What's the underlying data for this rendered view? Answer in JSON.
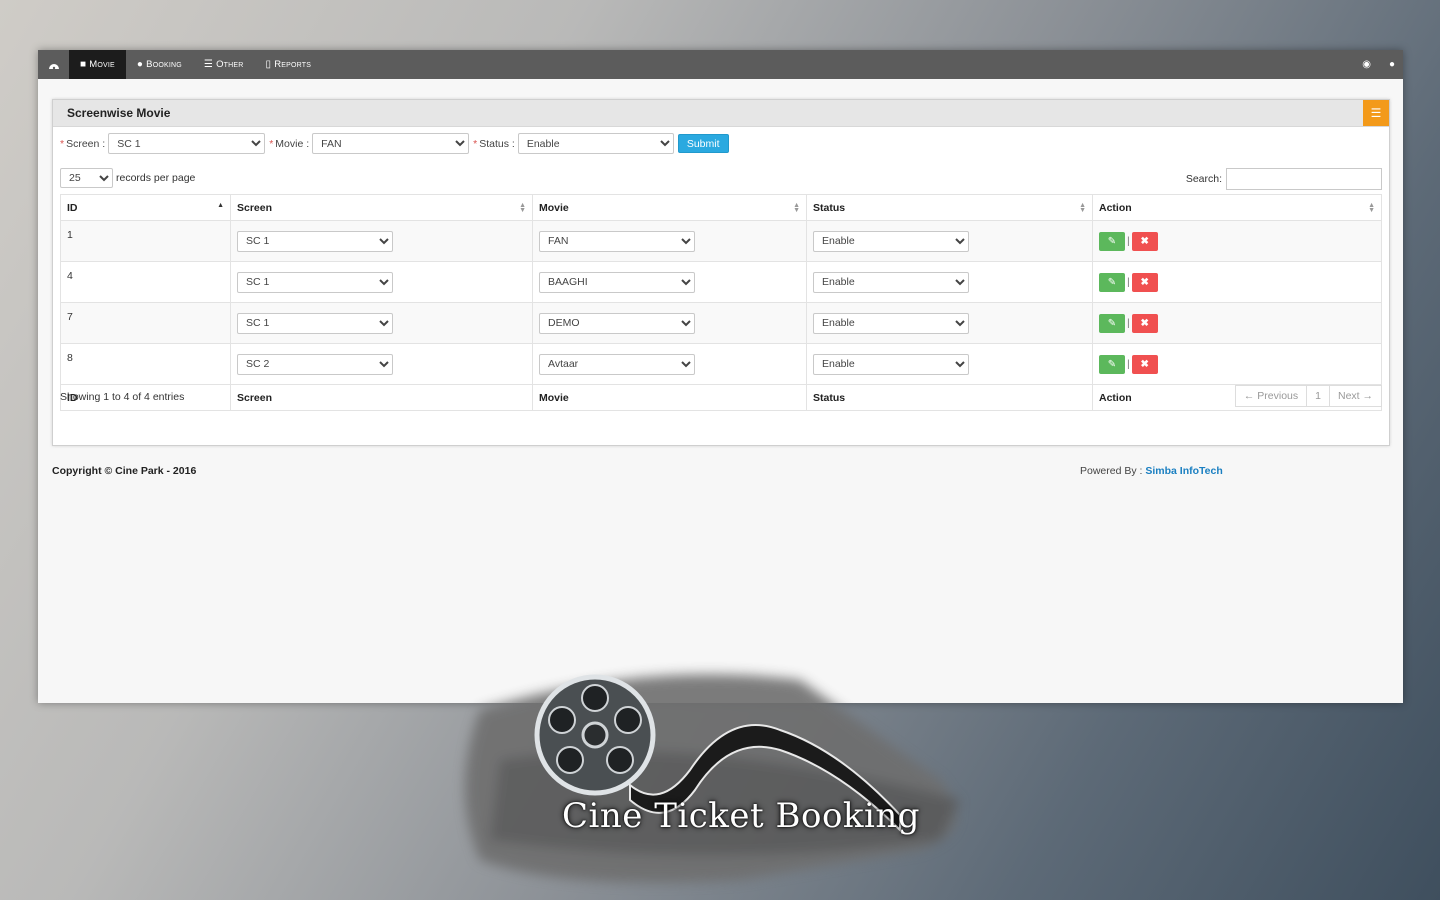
{
  "nav": {
    "items": [
      {
        "label": "Movie",
        "icon": "video-camera-icon",
        "active": true
      },
      {
        "label": "Booking",
        "icon": "user-icon",
        "active": false
      },
      {
        "label": "Other",
        "icon": "list-icon",
        "active": false
      },
      {
        "label": "Reports",
        "icon": "document-icon",
        "active": false
      }
    ]
  },
  "panel": {
    "title": "Screenwise Movie"
  },
  "filter": {
    "screen_label": "Screen :",
    "screen_value": "SC 1",
    "movie_label": "Movie :",
    "movie_value": "FAN",
    "status_label": "Status :",
    "status_value": "Enable",
    "submit_label": "Submit"
  },
  "table_controls": {
    "page_length": "25",
    "records_label": "records per page",
    "search_label": "Search:"
  },
  "table": {
    "headers": [
      "ID",
      "Screen",
      "Movie",
      "Status",
      "Action"
    ],
    "rows": [
      {
        "id": "1",
        "screen": "SC 1",
        "movie": "FAN",
        "status": "Enable"
      },
      {
        "id": "4",
        "screen": "SC 1",
        "movie": "BAAGHI",
        "status": "Enable"
      },
      {
        "id": "7",
        "screen": "SC 1",
        "movie": "DEMO",
        "status": "Enable"
      },
      {
        "id": "8",
        "screen": "SC 2",
        "movie": "Avtaar",
        "status": "Enable"
      }
    ]
  },
  "pagination": {
    "info": "Showing 1 to 4 of 4 entries",
    "previous": "← Previous",
    "page": "1",
    "next": "Next →"
  },
  "footer": {
    "copyright": "Copyright © Cine Park - 2016",
    "powered_by": "Powered By :",
    "company": "Simba InfoTech"
  },
  "branding": {
    "logo_text": "Cine Ticket Booking"
  },
  "colors": {
    "submit": "#2aa9e0",
    "edit": "#5cb85c",
    "delete": "#f05050",
    "panel_tool": "#f39a1a",
    "nav": "#5c5c5c"
  }
}
